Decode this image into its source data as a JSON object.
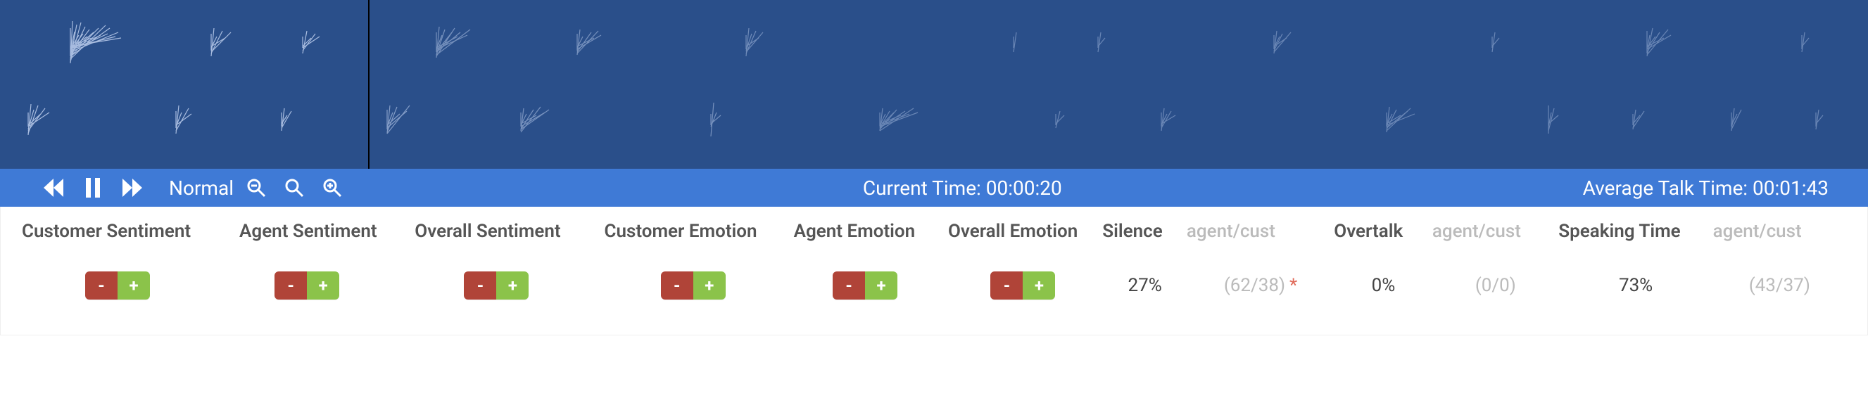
{
  "controls": {
    "speed_label": "Normal",
    "current_time_label": "Current Time: ",
    "current_time_value": "00:00:20",
    "avg_talk_label": "Average Talk Time: ",
    "avg_talk_value": "00:01:43"
  },
  "headers": {
    "customer_sentiment": "Customer Sentiment",
    "agent_sentiment": "Agent Sentiment",
    "overall_sentiment": "Overall Sentiment",
    "customer_emotion": "Customer Emotion",
    "agent_emotion": "Agent Emotion",
    "overall_emotion": "Overall Emotion",
    "silence": "Silence",
    "agent_cust": "agent/cust",
    "overtalk": "Overtalk",
    "speaking_time": "Speaking Time"
  },
  "values": {
    "silence_pct": "27%",
    "silence_ratio": "(62/38)",
    "silence_asterisk": "*",
    "overtalk_pct": "0%",
    "overtalk_ratio": "(0/0)",
    "speaking_pct": "73%",
    "speaking_ratio": "(43/37)"
  },
  "pm": {
    "minus": "-",
    "plus": "+"
  }
}
